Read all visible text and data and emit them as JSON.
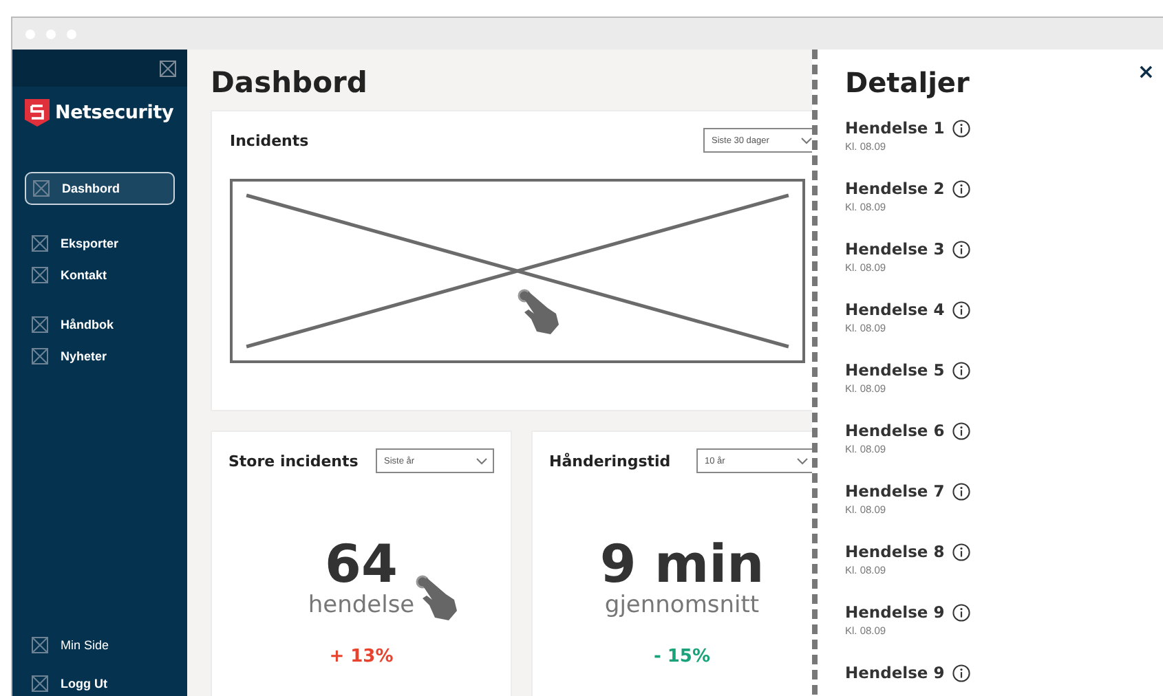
{
  "sidebar": {
    "brand": "Netsecurity",
    "nav_groups": [
      [
        {
          "label": "Dashbord",
          "selected": true
        }
      ],
      [
        {
          "label": "Eksporter",
          "selected": false
        },
        {
          "label": "Kontakt",
          "selected": false
        }
      ],
      [
        {
          "label": "Håndbok",
          "selected": false
        },
        {
          "label": "Nyheter",
          "selected": false
        }
      ]
    ],
    "bottom_items": [
      {
        "label": "Min Side",
        "bold": false
      },
      {
        "label": "Logg Ut",
        "bold": true
      }
    ]
  },
  "main": {
    "title": "Dashbord",
    "incidents_card": {
      "title": "Incidents",
      "dropdown": "Siste 30 dager"
    },
    "stat_cards": [
      {
        "title": "Store incidents",
        "dropdown": "Siste år",
        "value": "64",
        "unit": "hendelse",
        "change": "+ 13%",
        "color": "#e8432f",
        "pointer": true
      },
      {
        "title": "Hånderingstid",
        "dropdown": "10 år",
        "value": "9 min",
        "unit": "gjennomsnitt",
        "change": "- 15%",
        "color": "#1aa37a",
        "pointer": false
      }
    ]
  },
  "details_panel": {
    "title": "Detaljer",
    "close": "×",
    "items": [
      {
        "title": "Hendelse 1",
        "time": "Kl. 08.09"
      },
      {
        "title": "Hendelse 2",
        "time": "Kl. 08.09"
      },
      {
        "title": "Hendelse 3",
        "time": "Kl. 08.09"
      },
      {
        "title": "Hendelse 4",
        "time": "Kl. 08.09"
      },
      {
        "title": "Hendelse 5",
        "time": "Kl. 08.09"
      },
      {
        "title": "Hendelse 6",
        "time": "Kl. 08.09"
      },
      {
        "title": "Hendelse 7",
        "time": "Kl. 08.09"
      },
      {
        "title": "Hendelse 8",
        "time": "Kl. 08.09"
      },
      {
        "title": "Hendelse 9",
        "time": "Kl. 08.09"
      },
      {
        "title": "Hendelse 9"
      }
    ]
  }
}
